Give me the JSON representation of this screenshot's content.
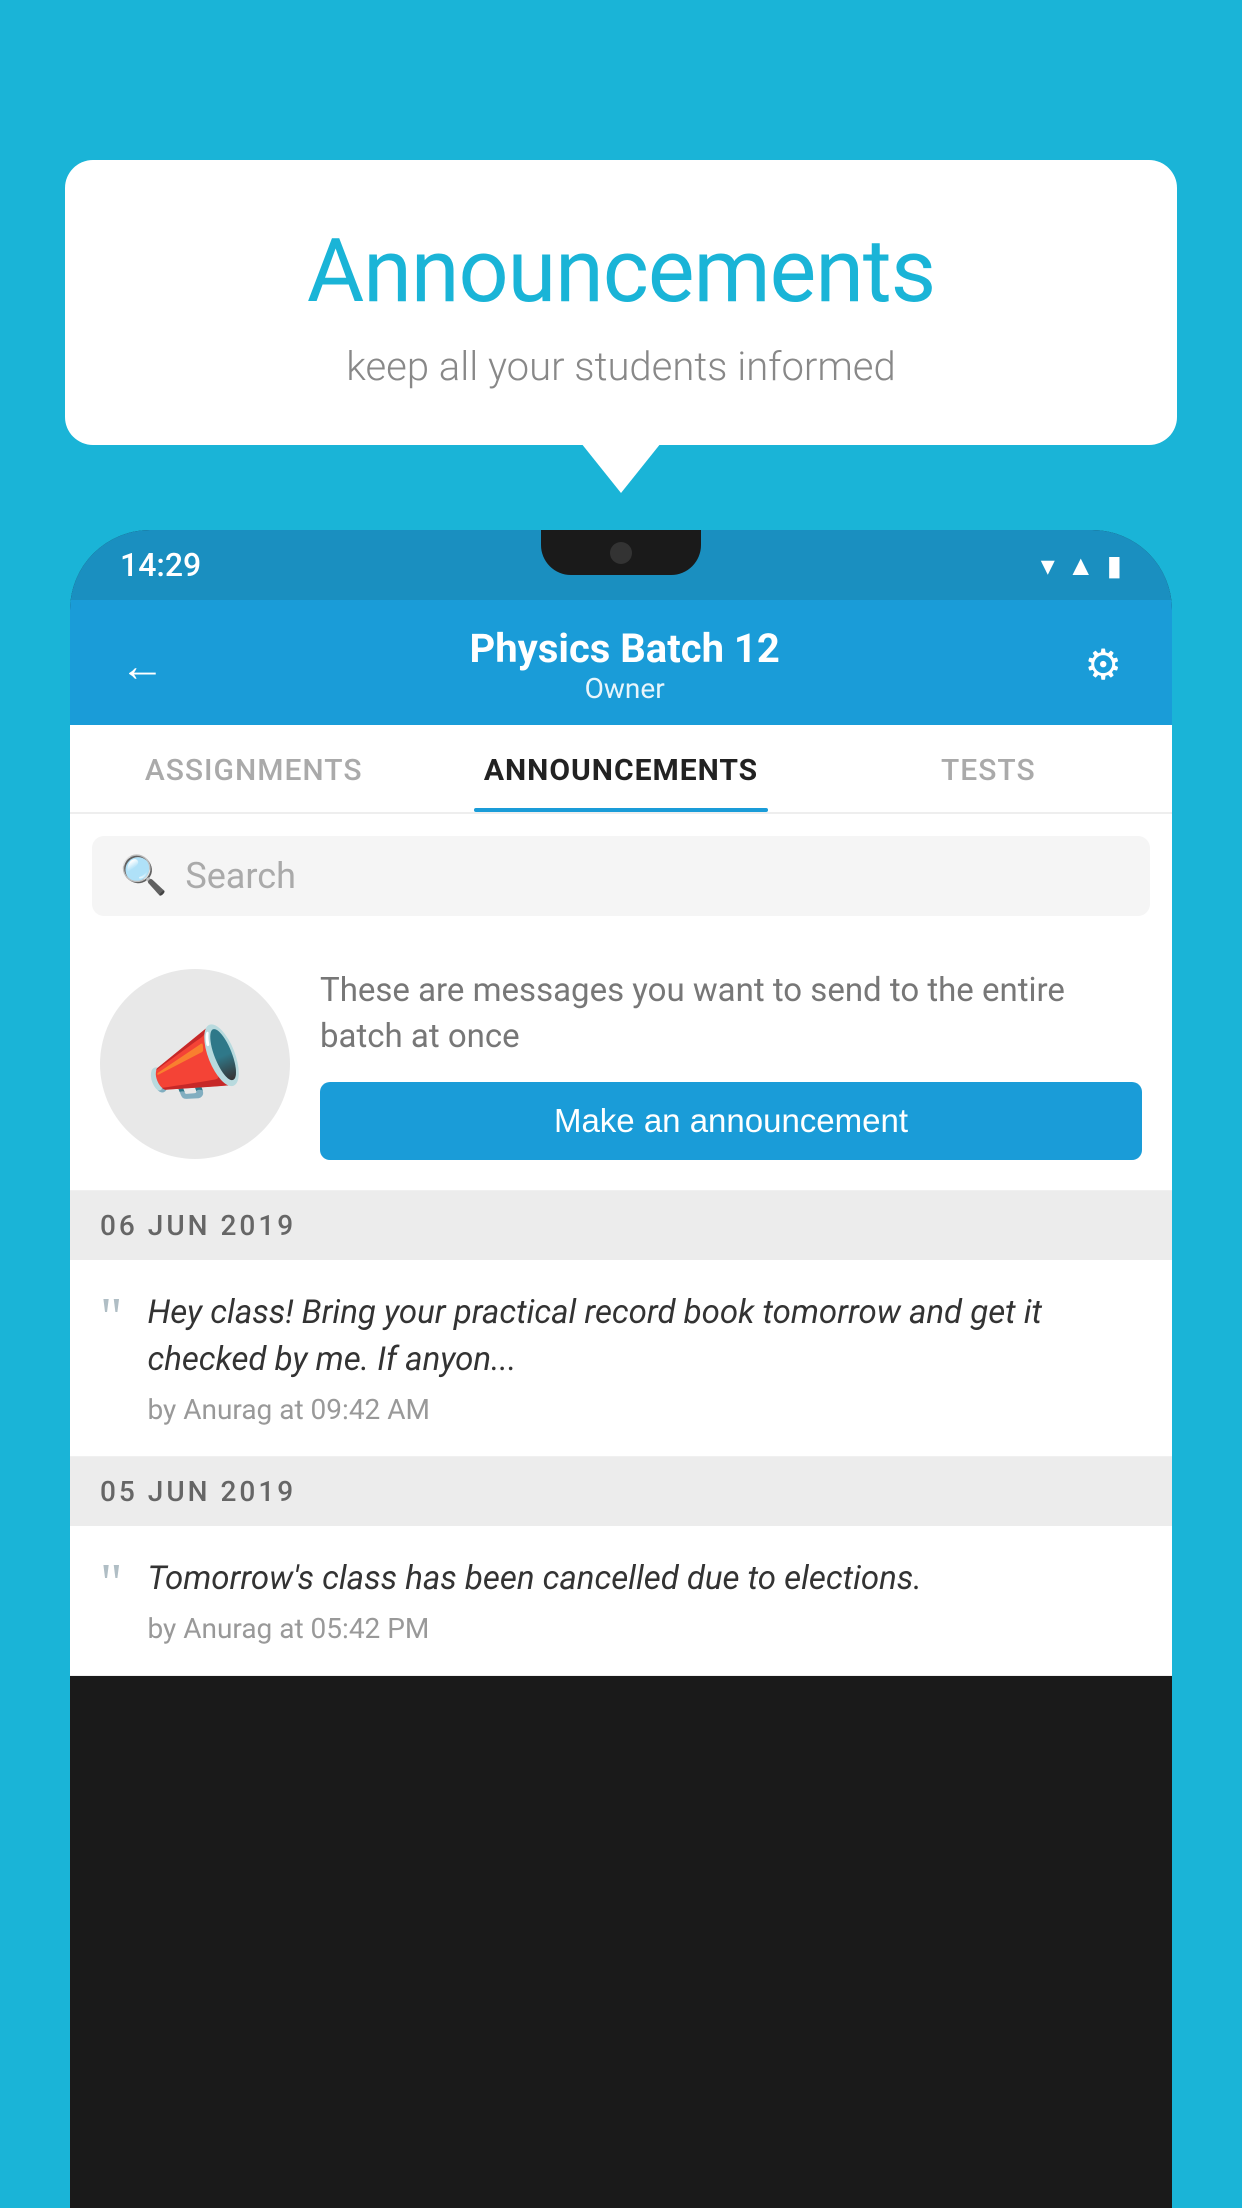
{
  "background_color": "#1ab4d7",
  "speech_bubble": {
    "title": "Announcements",
    "subtitle": "keep all your students informed"
  },
  "status_bar": {
    "time": "14:29",
    "icons": [
      "wifi",
      "signal",
      "battery"
    ]
  },
  "header": {
    "title": "Physics Batch 12",
    "subtitle": "Owner",
    "back_label": "←",
    "settings_label": "⚙"
  },
  "tabs": [
    {
      "label": "ASSIGNMENTS",
      "active": false
    },
    {
      "label": "ANNOUNCEMENTS",
      "active": true
    },
    {
      "label": "TESTS",
      "active": false
    }
  ],
  "search": {
    "placeholder": "Search"
  },
  "promo": {
    "description": "These are messages you want to send to the entire batch at once",
    "button_label": "Make an announcement"
  },
  "date_sections": [
    {
      "date": "06  JUN  2019",
      "announcements": [
        {
          "text": "Hey class! Bring your practical record book tomorrow and get it checked by me. If anyon...",
          "meta": "by Anurag at 09:42 AM"
        }
      ]
    },
    {
      "date": "05  JUN  2019",
      "announcements": [
        {
          "text": "Tomorrow's class has been cancelled due to elections.",
          "meta": "by Anurag at 05:42 PM"
        }
      ]
    }
  ]
}
